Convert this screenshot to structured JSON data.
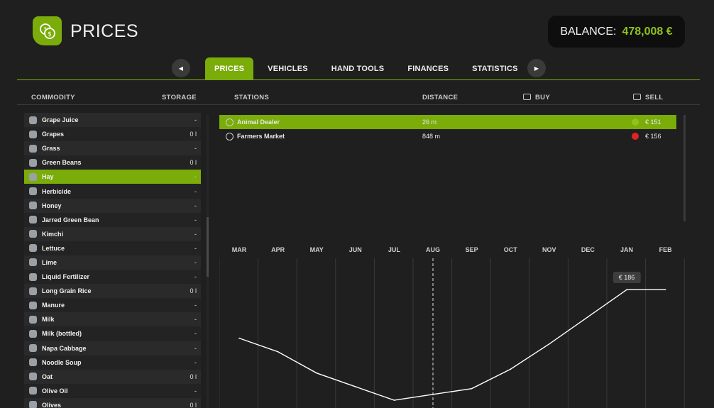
{
  "header": {
    "title": "PRICES",
    "balance_label": "BALANCE:",
    "balance_value": "478,008 €",
    "icon": "coins-icon",
    "accent_color": "#7aac0a"
  },
  "tabs": [
    {
      "label": "PRICES",
      "active": true
    },
    {
      "label": "VEHICLES",
      "active": false
    },
    {
      "label": "HAND TOOLS",
      "active": false
    },
    {
      "label": "FINANCES",
      "active": false
    },
    {
      "label": "STATISTICS",
      "active": false
    }
  ],
  "nav": {
    "prev_glyph": "◀",
    "next_glyph": "▶"
  },
  "columns": {
    "commodity": "COMMODITY",
    "storage": "STORAGE",
    "stations": "STATIONS",
    "distance": "DISTANCE",
    "buy": "BUY",
    "sell": "SELL"
  },
  "commodities": [
    {
      "name": "Grape Juice",
      "storage": "-",
      "icon": "juice-icon"
    },
    {
      "name": "Grapes",
      "storage": "0 l",
      "icon": "grapes-icon"
    },
    {
      "name": "Grass",
      "storage": "-",
      "icon": "grass-icon"
    },
    {
      "name": "Green Beans",
      "storage": "0 l",
      "icon": "green-beans-icon"
    },
    {
      "name": "Hay",
      "storage": "-",
      "icon": "hay-icon",
      "selected": true
    },
    {
      "name": "Herbicide",
      "storage": "-",
      "icon": "herbicide-icon"
    },
    {
      "name": "Honey",
      "storage": "-",
      "icon": "honey-icon"
    },
    {
      "name": "Jarred Green Bean",
      "storage": "-",
      "icon": "jar-icon"
    },
    {
      "name": "Kimchi",
      "storage": "-",
      "icon": "kimchi-icon"
    },
    {
      "name": "Lettuce",
      "storage": "-",
      "icon": "lettuce-icon"
    },
    {
      "name": "Lime",
      "storage": "-",
      "icon": "lime-icon"
    },
    {
      "name": "Liquid Fertilizer",
      "storage": "-",
      "icon": "fertilizer-icon"
    },
    {
      "name": "Long Grain Rice",
      "storage": "0 l",
      "icon": "rice-icon"
    },
    {
      "name": "Manure",
      "storage": "-",
      "icon": "manure-icon"
    },
    {
      "name": "Milk",
      "storage": "-",
      "icon": "milk-icon"
    },
    {
      "name": "Milk (bottled)",
      "storage": "-",
      "icon": "milk-bottle-icon"
    },
    {
      "name": "Napa Cabbage",
      "storage": "-",
      "icon": "cabbage-icon"
    },
    {
      "name": "Noodle Soup",
      "storage": "-",
      "icon": "soup-icon"
    },
    {
      "name": "Oat",
      "storage": "0 l",
      "icon": "oat-icon"
    },
    {
      "name": "Olive Oil",
      "storage": "-",
      "icon": "olive-oil-icon"
    },
    {
      "name": "Olives",
      "storage": "0 l",
      "icon": "olives-icon"
    }
  ],
  "stations": [
    {
      "name": "Animal Dealer",
      "distance": "26 m",
      "price": "€ 151",
      "trend_color": "#8ec31a",
      "selected": true
    },
    {
      "name": "Farmers Market",
      "distance": "848 m",
      "price": "€ 156",
      "trend_color": "#e02424",
      "selected": false
    }
  ],
  "chart_data": {
    "type": "line",
    "categories": [
      "MAR",
      "APR",
      "MAY",
      "JUN",
      "JUL",
      "AUG",
      "SEP",
      "OCT",
      "NOV",
      "DEC",
      "JAN",
      "FEB"
    ],
    "series": [
      {
        "values": [
          161,
          154,
          143,
          136,
          129,
          132,
          135,
          145,
          158,
          172,
          186,
          186
        ],
        "color": "#ffffff"
      }
    ],
    "current_month": "AUG",
    "highlight_label": "€ 186",
    "ylim": [
      125,
      200
    ],
    "grid": true
  }
}
